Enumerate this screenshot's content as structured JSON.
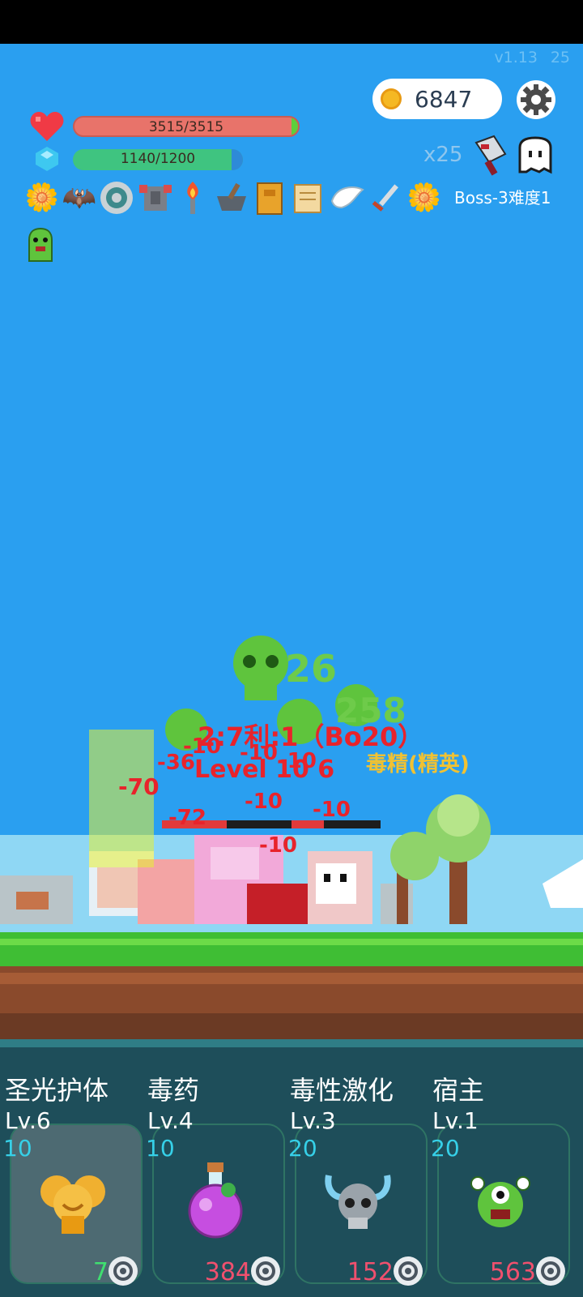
{
  "header": {
    "version": "v1.13",
    "version_extra": "25",
    "coins": "6847",
    "hp_text": "3515/3515",
    "mp_text": "1140/1200",
    "multiplier": "x25",
    "boss_label": "Boss-3难度1"
  },
  "hp": {
    "value": 3515,
    "max": 3515
  },
  "mp": {
    "value": 1140,
    "max": 1200
  },
  "buffs": [
    "flower-icon",
    "bat-icon",
    "ring-icon",
    "armor-icon",
    "torch-icon",
    "mortar-icon",
    "book-icon",
    "scroll-icon",
    "wing-icon",
    "sword-icon",
    "flower-icon"
  ],
  "battle": {
    "damage_big": "26",
    "damage_mid": "258",
    "boss_text": "2:7利:1（Bo20）",
    "level_text": "Level 10 6",
    "elite_text": "毒精(精英)",
    "hits": [
      "-70",
      "-36",
      "-10",
      "-10",
      "-10",
      "-10",
      "-10",
      "-72",
      "-10"
    ]
  },
  "skills": [
    {
      "name": "圣光护体",
      "level": "Lv.6",
      "cost": "10",
      "count": "7",
      "count_color": "#3fe070",
      "dim": true
    },
    {
      "name": "毒药",
      "level": "Lv.4",
      "cost": "10",
      "count": "384",
      "count_color": "#f0506e",
      "dim": false
    },
    {
      "name": "毒性激化",
      "level": "Lv.3",
      "cost": "20",
      "count": "152",
      "count_color": "#f0506e",
      "dim": false
    },
    {
      "name": "宿主",
      "level": "Lv.1",
      "cost": "20",
      "count": "563",
      "count_color": "#f0506e",
      "dim": false
    }
  ],
  "colors": {
    "sky": "#2a9ff0",
    "panel": "#1e4e5a",
    "cost": "#36d0e8"
  }
}
